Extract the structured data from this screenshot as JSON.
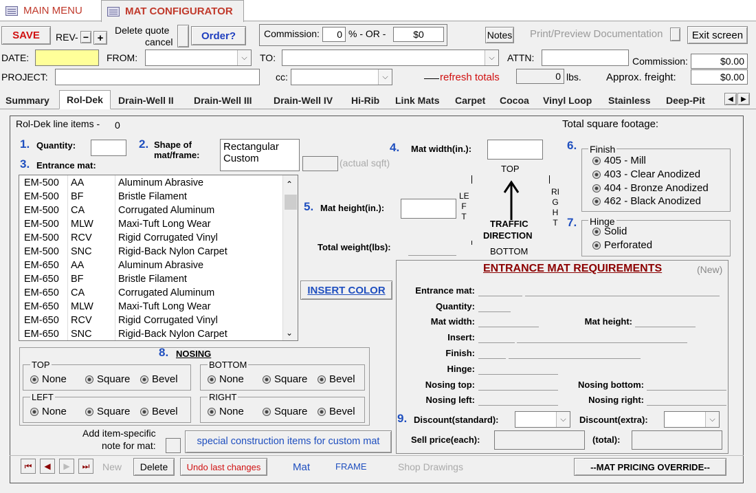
{
  "doc_tabs": [
    {
      "label": "MAIN MENU"
    },
    {
      "label": "MAT CONFIGURATOR"
    }
  ],
  "toolbar": {
    "save": "SAVE",
    "rev": "REV-",
    "rev_minus": "−",
    "rev_plus": "+",
    "delete_quote": "Delete quote",
    "cancel": "cancel",
    "order": "Order?",
    "commission_label": "Commission:",
    "commission_value": "0",
    "percent_or": "% - OR -",
    "commission_amount": "$0",
    "notes": "Notes",
    "print_preview": "Print/Preview Documentation",
    "exit": "Exit screen"
  },
  "header": {
    "date_label": "DATE:",
    "from_label": "FROM:",
    "to_label": "TO:",
    "attn_label": "ATTN:",
    "commission_label": "Commission:",
    "commission_value": "$0.00",
    "project_label": "PROJECT:",
    "cc_label": "cc:",
    "refresh_totals": "refresh totals",
    "weight_value": "0",
    "weight_unit": "lbs.",
    "freight_label": "Approx. freight:",
    "freight_value": "$0.00"
  },
  "tabs": [
    "Summary",
    "Rol-Dek",
    "Drain-Well II",
    "Drain-Well III",
    "Drain-Well IV",
    "Hi-Rib",
    "Link Mats",
    "Carpet",
    "Cocoa",
    "Vinyl Loop",
    "Stainless",
    "Deep-Pit"
  ],
  "panel": {
    "line_items_label": "Rol-Dek line items -",
    "line_items_count": "0",
    "total_sqft_label": "Total square footage:",
    "n1": "1.",
    "quantity_label": "Quantity:",
    "n2": "2.",
    "shape_label_1": "Shape of",
    "shape_label_2": "mat/frame:",
    "shape_options": [
      "Rectangular",
      "Custom"
    ],
    "actual_sqft": "(actual sqft)",
    "n3": "3.",
    "entrance_mat_label": "Entrance mat:",
    "n4": "4.",
    "mat_width_label": "Mat width(in.):",
    "top": "TOP",
    "left": "LE F T",
    "right": "RI G H T",
    "n5": "5.",
    "mat_height_label": "Mat height(in.):",
    "traffic": "TRAFFIC",
    "direction": "DIRECTION",
    "bottom": "BOTTOM",
    "total_weight_label": "Total weight(lbs):",
    "n6": "6.",
    "finish_label": "Finish",
    "finish_options": [
      "405 - Mill",
      "403 - Clear Anodized",
      "404 - Bronze Anodized",
      "462 - Black Anodized"
    ],
    "n7": "7.",
    "hinge_label": "Hinge",
    "hinge_options": [
      "Solid",
      "Perforated"
    ],
    "insert_color": "INSERT COLOR",
    "n8": "8.",
    "nosing_label": "NOSING",
    "nosing_groups": {
      "top": "TOP",
      "bottom": "BOTTOM",
      "left": "LEFT",
      "right": "RIGHT"
    },
    "nosing_options": [
      "None",
      "Square",
      "Bevel"
    ],
    "add_note_1": "Add item-specific",
    "add_note_2": "note for mat:",
    "special_construction": "special construction items for custom mat"
  },
  "mat_list": [
    [
      "EM-500",
      "AA",
      "Aluminum Abrasive"
    ],
    [
      "EM-500",
      "BF",
      "Bristle Filament"
    ],
    [
      "EM-500",
      "CA",
      "Corrugated Aluminum"
    ],
    [
      "EM-500",
      "MLW",
      "Maxi-Tuft Long Wear"
    ],
    [
      "EM-500",
      "RCV",
      "Rigid Corrugated Vinyl"
    ],
    [
      "EM-500",
      "SNC",
      "Rigid-Back Nylon Carpet"
    ],
    [
      "EM-650",
      "AA",
      "Aluminum Abrasive"
    ],
    [
      "EM-650",
      "BF",
      "Bristle Filament"
    ],
    [
      "EM-650",
      "CA",
      "Corrugated Aluminum"
    ],
    [
      "EM-650",
      "MLW",
      "Maxi-Tuft Long Wear"
    ],
    [
      "EM-650",
      "RCV",
      "Rigid Corrugated Vinyl"
    ],
    [
      "EM-650",
      "SNC",
      "Rigid-Back Nylon Carpet"
    ]
  ],
  "requirements": {
    "title": "ENTRANCE MAT REQUIREMENTS",
    "new": "(New)",
    "entrance_mat": "Entrance mat:",
    "quantity": "Quantity:",
    "mat_width": "Mat width:",
    "mat_height": "Mat height:",
    "insert": "Insert:",
    "finish": "Finish:",
    "hinge": "Hinge:",
    "nosing_top": "Nosing top:",
    "nosing_bottom": "Nosing bottom:",
    "nosing_left": "Nosing left:",
    "nosing_right": "Nosing right:",
    "n9": "9.",
    "discount_standard": "Discount(standard):",
    "discount_extra": "Discount(extra):",
    "sell_price": "Sell price(each):",
    "total": "(total):"
  },
  "bottom": {
    "new": "New",
    "delete": "Delete",
    "undo": "Undo last changes",
    "mat": "Mat",
    "frame": "FRAME",
    "shop_drawings": "Shop Drawings",
    "override": "--MAT PRICING OVERRIDE--"
  },
  "colors": {
    "accent_red": "#c0392b",
    "link_blue": "#1f4fbf",
    "date_yellow": "#ffff99"
  }
}
